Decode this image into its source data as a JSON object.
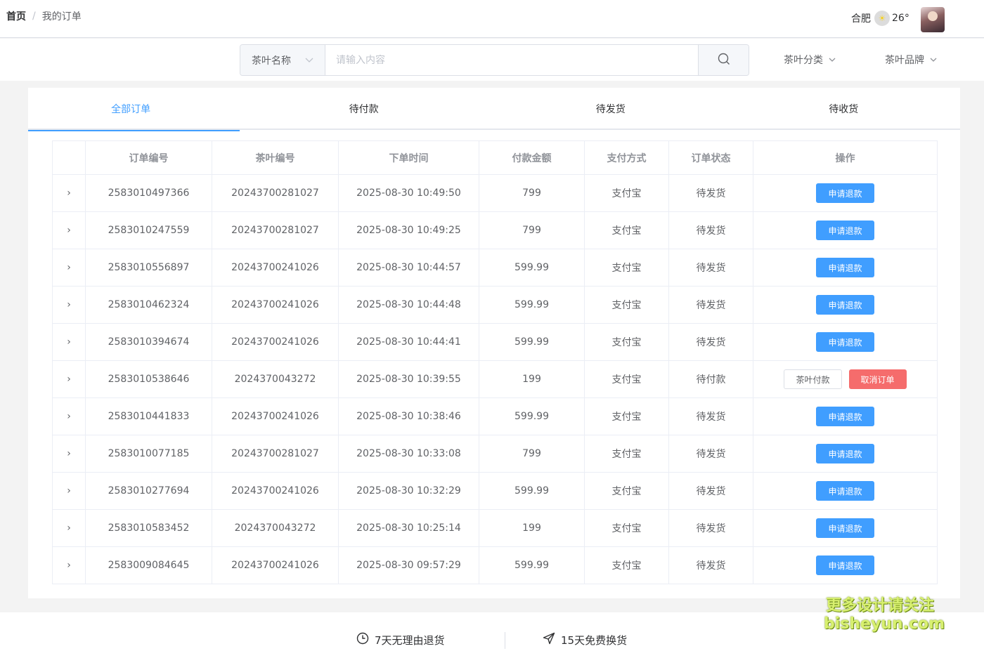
{
  "breadcrumb": {
    "home": "首页",
    "separator": "/",
    "current": "我的订单"
  },
  "weather": {
    "city": "合肥",
    "icon": "sunny-icon",
    "temperature": "26°"
  },
  "search": {
    "select_label": "茶叶名称",
    "placeholder": "请输入内容",
    "icon": "search-icon"
  },
  "filters": {
    "category_label": "茶叶分类",
    "brand_label": "茶叶品牌"
  },
  "tabs": [
    {
      "label": "全部订单",
      "active": true
    },
    {
      "label": "待付款",
      "active": false
    },
    {
      "label": "待发货",
      "active": false
    },
    {
      "label": "待收货",
      "active": false
    }
  ],
  "table": {
    "headers": [
      "",
      "订单编号",
      "茶叶编号",
      "下单时间",
      "付款金额",
      "支付方式",
      "订单状态",
      "操作"
    ],
    "rows": [
      {
        "expand": "›",
        "order_no": "2583010497366",
        "tea_no": "20243700281027",
        "time": "2025-08-30 10:49:50",
        "amount": "799",
        "pay": "支付宝",
        "status": "待发货",
        "actions": [
          "申请退款"
        ]
      },
      {
        "expand": "›",
        "order_no": "2583010247559",
        "tea_no": "20243700281027",
        "time": "2025-08-30 10:49:25",
        "amount": "799",
        "pay": "支付宝",
        "status": "待发货",
        "actions": [
          "申请退款"
        ]
      },
      {
        "expand": "›",
        "order_no": "2583010556897",
        "tea_no": "20243700241026",
        "time": "2025-08-30 10:44:57",
        "amount": "599.99",
        "pay": "支付宝",
        "status": "待发货",
        "actions": [
          "申请退款"
        ]
      },
      {
        "expand": "›",
        "order_no": "2583010462324",
        "tea_no": "20243700241026",
        "time": "2025-08-30 10:44:48",
        "amount": "599.99",
        "pay": "支付宝",
        "status": "待发货",
        "actions": [
          "申请退款"
        ]
      },
      {
        "expand": "›",
        "order_no": "2583010394674",
        "tea_no": "20243700241026",
        "time": "2025-08-30 10:44:41",
        "amount": "599.99",
        "pay": "支付宝",
        "status": "待发货",
        "actions": [
          "申请退款"
        ]
      },
      {
        "expand": "›",
        "order_no": "2583010538646",
        "tea_no": "2024370043272",
        "time": "2025-08-30 10:39:55",
        "amount": "199",
        "pay": "支付宝",
        "status": "待付款",
        "actions": [
          "茶叶付款",
          "取消订单"
        ]
      },
      {
        "expand": "›",
        "order_no": "2583010441833",
        "tea_no": "20243700241026",
        "time": "2025-08-30 10:38:46",
        "amount": "599.99",
        "pay": "支付宝",
        "status": "待发货",
        "actions": [
          "申请退款"
        ]
      },
      {
        "expand": "›",
        "order_no": "2583010077185",
        "tea_no": "20243700281027",
        "time": "2025-08-30 10:33:08",
        "amount": "799",
        "pay": "支付宝",
        "status": "待发货",
        "actions": [
          "申请退款"
        ]
      },
      {
        "expand": "›",
        "order_no": "2583010277694",
        "tea_no": "20243700241026",
        "time": "2025-08-30 10:32:29",
        "amount": "599.99",
        "pay": "支付宝",
        "status": "待发货",
        "actions": [
          "申请退款"
        ]
      },
      {
        "expand": "›",
        "order_no": "2583010583452",
        "tea_no": "2024370043272",
        "time": "2025-08-30 10:25:14",
        "amount": "199",
        "pay": "支付宝",
        "status": "待发货",
        "actions": [
          "申请退款"
        ]
      },
      {
        "expand": "›",
        "order_no": "2583009084645",
        "tea_no": "20243700241026",
        "time": "2025-08-30 09:57:29",
        "amount": "599.99",
        "pay": "支付宝",
        "status": "待发货",
        "actions": [
          "申请退款"
        ]
      }
    ]
  },
  "footer": {
    "feature1": {
      "icon": "clock-icon",
      "label": "7天无理由退货"
    },
    "feature2": {
      "icon": "send-icon",
      "label": "15天免费换货"
    }
  },
  "watermark": {
    "line1": "更多设计请关注",
    "line2": "bisheyun.com"
  },
  "colors": {
    "primary": "#409eff",
    "danger": "#f56c6c",
    "border": "#ebeef5"
  }
}
